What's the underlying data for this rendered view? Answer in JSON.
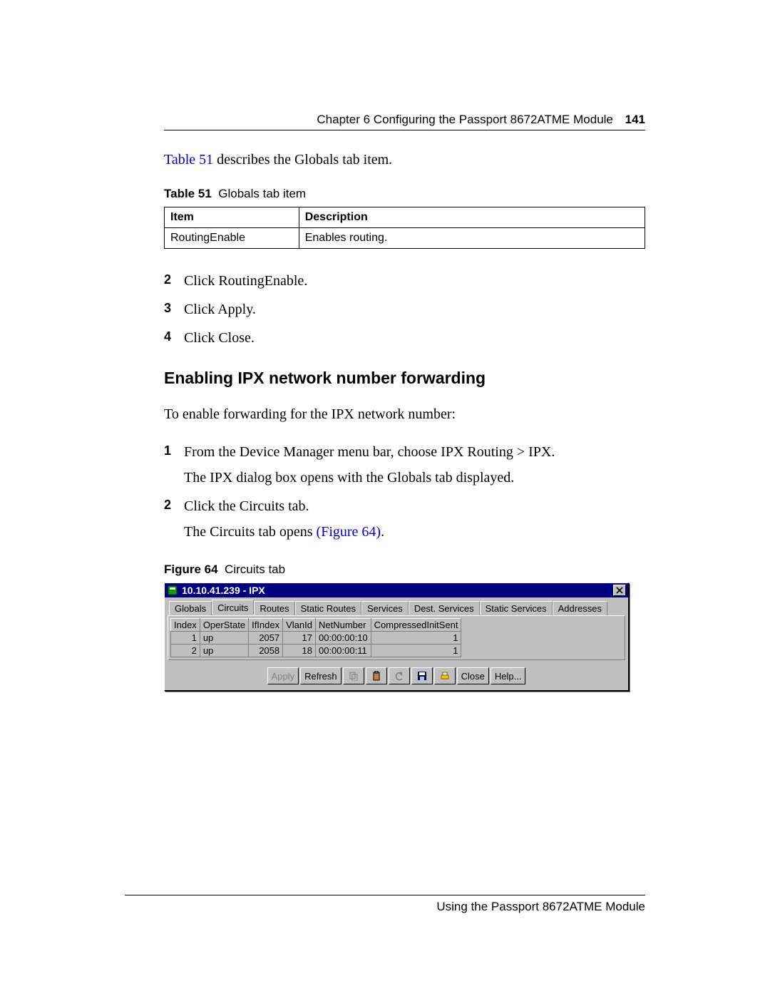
{
  "header": {
    "chapter": "Chapter 6  Configuring the Passport 8672ATME Module",
    "page_number": "141"
  },
  "intro": {
    "link": "Table 51",
    "rest": " describes the Globals tab item."
  },
  "table51": {
    "caption_label": "Table 51",
    "caption_text": "Globals tab item",
    "headers": [
      "Item",
      "Description"
    ],
    "row": [
      "RoutingEnable",
      "Enables routing."
    ]
  },
  "steps_a": [
    {
      "n": "2",
      "text": "Click RoutingEnable."
    },
    {
      "n": "3",
      "text": "Click Apply."
    },
    {
      "n": "4",
      "text": "Click Close."
    }
  ],
  "section_heading": "Enabling IPX network number forwarding",
  "section_intro": "To enable forwarding for the IPX network number:",
  "steps_b": [
    {
      "n": "1",
      "text": "From the Device Manager menu bar, choose IPX Routing > IPX.",
      "sub": "The IPX dialog box opens with the Globals tab displayed."
    },
    {
      "n": "2",
      "text": "Click the Circuits tab.",
      "sub_prefix": "The Circuits tab opens ",
      "sub_link": "(Figure 64)",
      "sub_suffix": "."
    }
  ],
  "figure64": {
    "caption_label": "Figure 64",
    "caption_text": "Circuits tab"
  },
  "dialog": {
    "title": "10.10.41.239 - IPX",
    "tabs": [
      "Globals",
      "Circuits",
      "Routes",
      "Static Routes",
      "Services",
      "Dest. Services",
      "Static Services",
      "Addresses"
    ],
    "active_tab": "Circuits",
    "grid_headers": [
      "Index",
      "OperState",
      "IfIndex",
      "VlanId",
      "NetNumber",
      "CompressedInitSent"
    ],
    "grid_rows": [
      [
        "1",
        "up",
        "2057",
        "17",
        "00:00:00:10",
        "1"
      ],
      [
        "2",
        "up",
        "2058",
        "18",
        "00:00:00:11",
        "1"
      ]
    ],
    "buttons": {
      "apply": "Apply",
      "refresh": "Refresh",
      "close": "Close",
      "help": "Help..."
    }
  },
  "footer": "Using the Passport 8672ATME Module"
}
